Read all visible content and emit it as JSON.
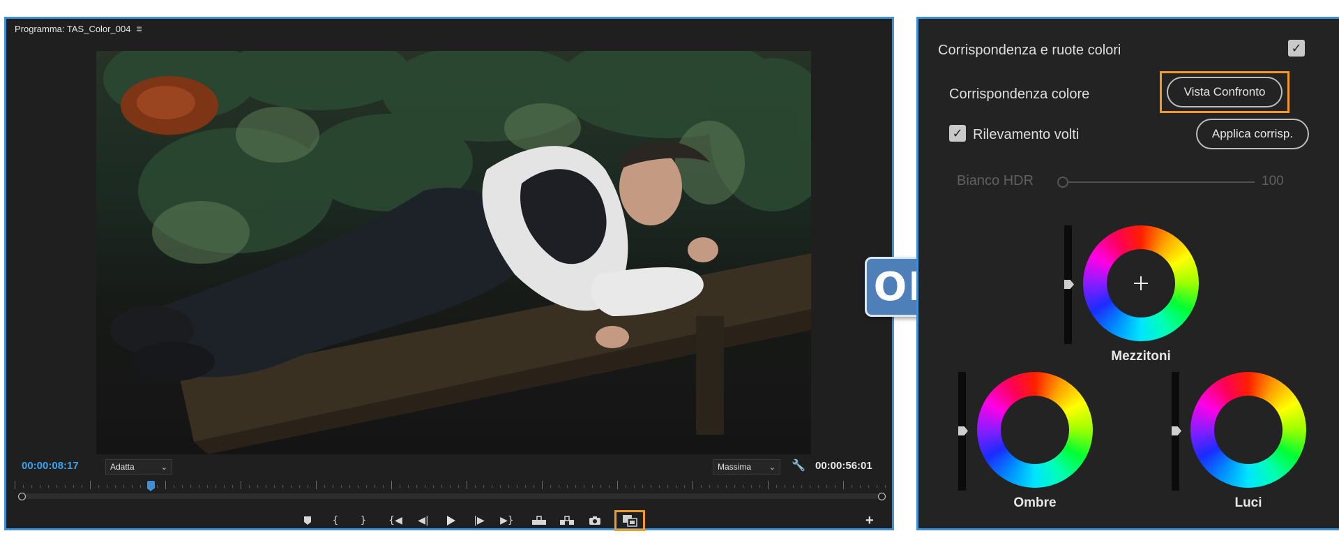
{
  "monitor": {
    "title": "Programma: TAS_Color_004",
    "menu_icon": "≡",
    "timecode_current": "00:00:08:17",
    "fit_select": "Adatta",
    "quality_select": "Massima",
    "timecode_duration": "00:00:56:01",
    "accent_color": "#3d8fd6",
    "highlight_color": "#f39a26",
    "transport_icons": [
      "marker-icon",
      "mark-in-icon",
      "mark-out-icon",
      "go-to-in-icon",
      "step-back-icon",
      "play-icon",
      "step-forward-icon",
      "go-to-out-icon",
      "lift-icon",
      "extract-icon",
      "export-frame-icon",
      "comparison-view-icon"
    ]
  },
  "badge": {
    "text": "OR"
  },
  "lumetri": {
    "section_title": "Corrispondenza e ruote colori",
    "section_enabled": true,
    "color_match_label": "Corrispondenza colore",
    "comparison_view_button": "Vista Confronto",
    "face_detection_label": "Rilevamento volti",
    "face_detection_checked": true,
    "apply_match_button": "Applica corrisp.",
    "hdr_white_label": "Bianco HDR",
    "hdr_white_value": "100",
    "wheels": {
      "midtones": "Mezzitoni",
      "shadows": "Ombre",
      "highlights": "Luci"
    }
  }
}
